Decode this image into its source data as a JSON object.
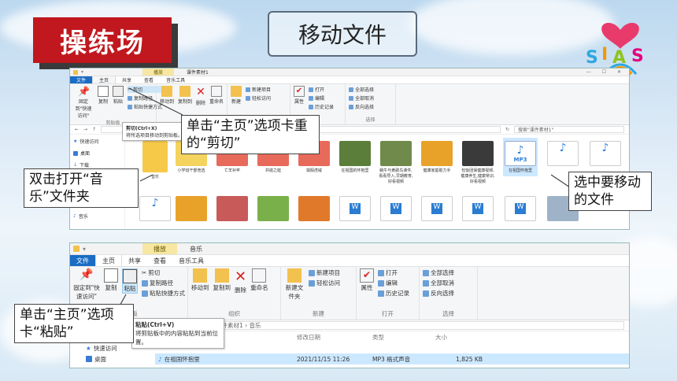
{
  "slide": {
    "badge": "操练场",
    "title": "移动文件",
    "logo_text": "SIAS"
  },
  "explorer1": {
    "context_tab": "播放",
    "window_name": "课件素材1",
    "tabs": [
      "文件",
      "主页",
      "共享",
      "查看",
      "音乐工具"
    ],
    "clipboard": {
      "pin": "固定到\"快速访问\"",
      "copy": "复制",
      "paste": "粘贴",
      "cut": "剪切",
      "copy_path": "复制路径",
      "paste_shortcut": "粘贴快捷方式",
      "label": "剪贴板"
    },
    "organize": {
      "move_to": "移动到",
      "copy_to": "复制到",
      "delete": "删除",
      "rename": "重命名"
    },
    "new": {
      "new_item": "新建项目",
      "easy_access": "轻松访问",
      "new_folder": "新建"
    },
    "open": {
      "properties": "属性",
      "open": "打开",
      "edit": "编辑",
      "history": "历史记录"
    },
    "select": {
      "select_all": "全部选择",
      "select_none": "全部取消",
      "invert": "反向选择",
      "label": "选择"
    },
    "tooltip_title": "剪切(Ctrl+X)",
    "tooltip_desc": "将所选项目移动到剪贴板。",
    "search_placeholder": "搜索\"课件素材1\"",
    "nav": [
      "快速访问",
      "桌面",
      "下载",
      "音乐"
    ],
    "files": [
      "音乐",
      "小学班干部竞选",
      "亡羊补牢",
      "井底之蛙",
      "狐假虎威",
      "在祖国的怀抱里",
      "蜗牛与黄鹂鸟课件,看看导入,早期教育,好看视频",
      "健康家庭助力手",
      "包饭团保健康视频,健康养生,健康常识,好看视频",
      "在祖国怀抱里"
    ],
    "mp3_label": "MP3"
  },
  "explorer2": {
    "context_tab": "播放",
    "window_name": "音乐",
    "tabs": [
      "文件",
      "主页",
      "共享",
      "查看",
      "音乐工具"
    ],
    "clipboard": {
      "pin": "固定到\"快速访问\"",
      "copy": "复制",
      "paste": "粘贴",
      "cut": "剪切",
      "copy_path": "复制路径",
      "paste_shortcut": "粘贴快捷方式",
      "label": "剪贴板"
    },
    "organize": {
      "move_to": "移动到",
      "copy_to": "复制到",
      "delete": "删除",
      "rename": "重命名",
      "label": "组织"
    },
    "new": {
      "new_item": "新建项目",
      "easy_access": "轻松访问",
      "new_folder": "新建文件夹",
      "label": "新建"
    },
    "open": {
      "properties": "属性",
      "open": "打开",
      "edit": "编辑",
      "history": "历史记录",
      "label": "打开"
    },
    "select": {
      "select_all": "全部选择",
      "select_none": "全部取消",
      "invert": "反向选择",
      "label": "选择"
    },
    "path": "E:) › 课件素材1 › 音乐",
    "tooltip_title": "粘贴(Ctrl+V)",
    "tooltip_desc": "将剪贴板中的内容粘贴到当前位置。",
    "columns": [
      "修改日期",
      "类型",
      "大小"
    ],
    "nav": [
      "快速访问",
      "桌面"
    ],
    "file": {
      "name": "在祖国怀抱里",
      "date": "2021/11/15 11:26",
      "type": "MP3 格式声音",
      "size": "1,825 KB"
    }
  },
  "callouts": {
    "cut": "单击“主页”选项卡重的“剪切”",
    "open_music": "双击打开“音乐”文件夹",
    "select_file": "选中要移动的文件",
    "paste": "单击“主页”选项卡“粘贴”"
  }
}
